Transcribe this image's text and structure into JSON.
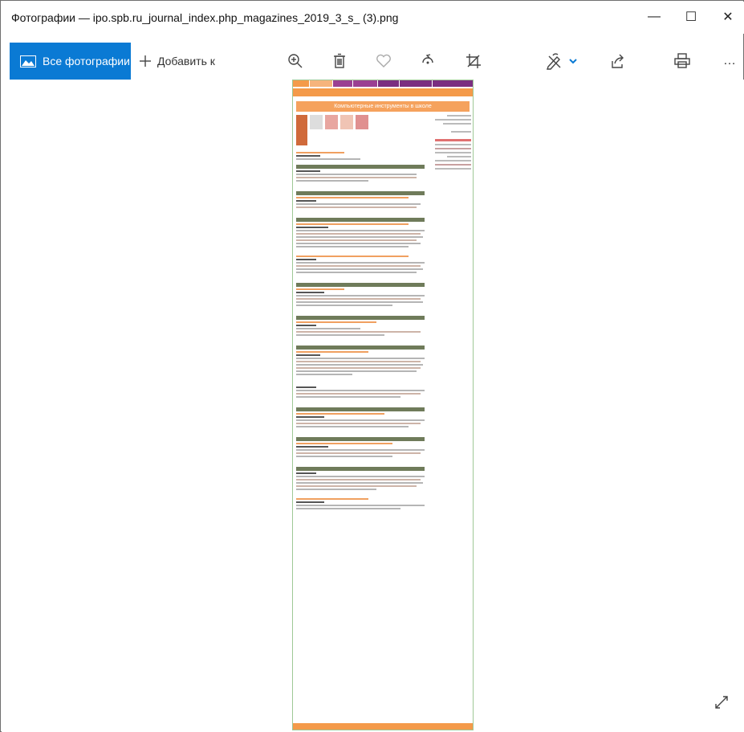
{
  "window": {
    "title": "Фотографии — ipo.spb.ru_journal_index.php_magazines_2019_3_s_ (3).png",
    "min_glyph": "—",
    "max_glyph": "☐",
    "close_glyph": "✕"
  },
  "toolbar": {
    "all_photos": "Все фотографии",
    "add": "Добавить к",
    "more": "…"
  },
  "page": {
    "banner": "Компьютерные инструменты в школе"
  },
  "colors": {
    "accent": "#0a7ad4",
    "nav": "#7b2e80",
    "orange": "#f49a4a",
    "section": "#6f7b5a",
    "border": "#9ec896"
  }
}
